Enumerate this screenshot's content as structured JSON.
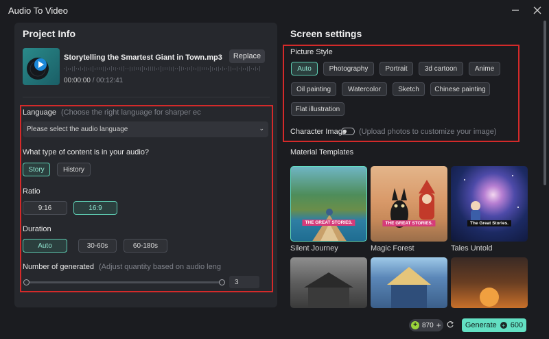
{
  "window": {
    "title": "Audio To Video"
  },
  "project": {
    "title": "Project Info",
    "file_name": "Storytelling the Smartest Giant in Town.mp3",
    "time_current": "00:00:00",
    "time_separator": "/",
    "time_total": "00:12:41",
    "replace_label": "Replace"
  },
  "language": {
    "label": "Language",
    "hint": "(Choose the right language for sharper ec",
    "placeholder": "Please select the audio language"
  },
  "content_type": {
    "label": "What type of content is in your audio?",
    "options": [
      "Story",
      "History"
    ],
    "selected": "Story"
  },
  "ratio": {
    "label": "Ratio",
    "options": [
      "9:16",
      "16:9"
    ],
    "selected": "16:9"
  },
  "duration": {
    "label": "Duration",
    "options": [
      "Auto",
      "30-60s",
      "60-180s"
    ],
    "selected": "Auto"
  },
  "generated": {
    "label": "Number of generated",
    "hint": "(Adjust quantity based on audio leng",
    "value": "3",
    "slider_level": 1.0
  },
  "screen": {
    "title": "Screen settings",
    "picture_style_label": "Picture Style",
    "styles": [
      "Auto",
      "Photography",
      "Portrait",
      "3d cartoon",
      "Anime",
      "Oil painting",
      "Watercolor",
      "Sketch",
      "Chinese painting",
      "Flat illustration"
    ],
    "selected_style": "Auto",
    "character_image_label": "Character Image",
    "character_image_hint": "(Upload photos to customize your image)",
    "character_image_on": false,
    "material_templates_label": "Material Templates",
    "templates": [
      {
        "name": "Silent Journey",
        "banner": "THE GREAT STORIES."
      },
      {
        "name": "Magic Forest",
        "banner": "THE GREAT STORIES."
      },
      {
        "name": "Tales Untold",
        "banner": "The Great Stories."
      }
    ]
  },
  "footer": {
    "credits": "870",
    "generate_label": "Generate",
    "generate_cost": "600"
  },
  "colors": {
    "accent": "#63e0c3",
    "highlight_box": "#d42a2a",
    "background": "#1b1c20",
    "panel": "#26282d"
  }
}
